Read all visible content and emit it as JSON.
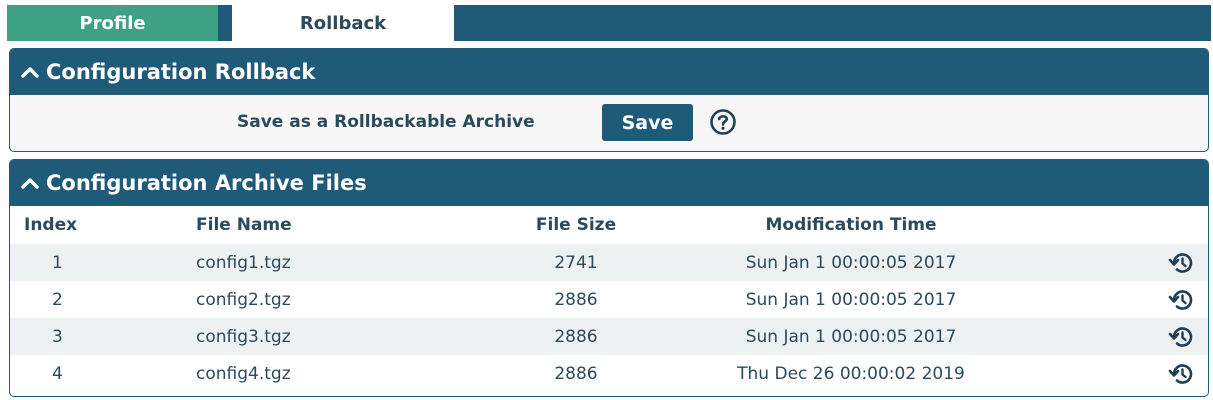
{
  "tabs": [
    {
      "label": "Profile",
      "active": false
    },
    {
      "label": "Rollback",
      "active": true
    }
  ],
  "rollback_panel": {
    "title": "Configuration Rollback",
    "save_label": "Save as a Rollbackable Archive",
    "save_button": "Save",
    "help_icon": "help-circle-icon"
  },
  "archive_panel": {
    "title": "Configuration Archive Files",
    "columns": [
      "Index",
      "File Name",
      "File Size",
      "Modification Time"
    ],
    "rows": [
      {
        "index": "1",
        "file_name": "config1.tgz",
        "file_size": "2741",
        "modification_time": "Sun Jan 1 00:00:05 2017"
      },
      {
        "index": "2",
        "file_name": "config2.tgz",
        "file_size": "2886",
        "modification_time": "Sun Jan 1 00:00:05 2017"
      },
      {
        "index": "3",
        "file_name": "config3.tgz",
        "file_size": "2886",
        "modification_time": "Sun Jan 1 00:00:05 2017"
      },
      {
        "index": "4",
        "file_name": "config4.tgz",
        "file_size": "2886",
        "modification_time": "Thu Dec 26 00:00:02 2019"
      }
    ],
    "row_action_icon": "restore-history-icon"
  },
  "colors": {
    "header_bg": "#1f5a78",
    "profile_tab_bg": "#3fa183",
    "text": "#2b4a5c",
    "stripe": "#eef1f2"
  }
}
